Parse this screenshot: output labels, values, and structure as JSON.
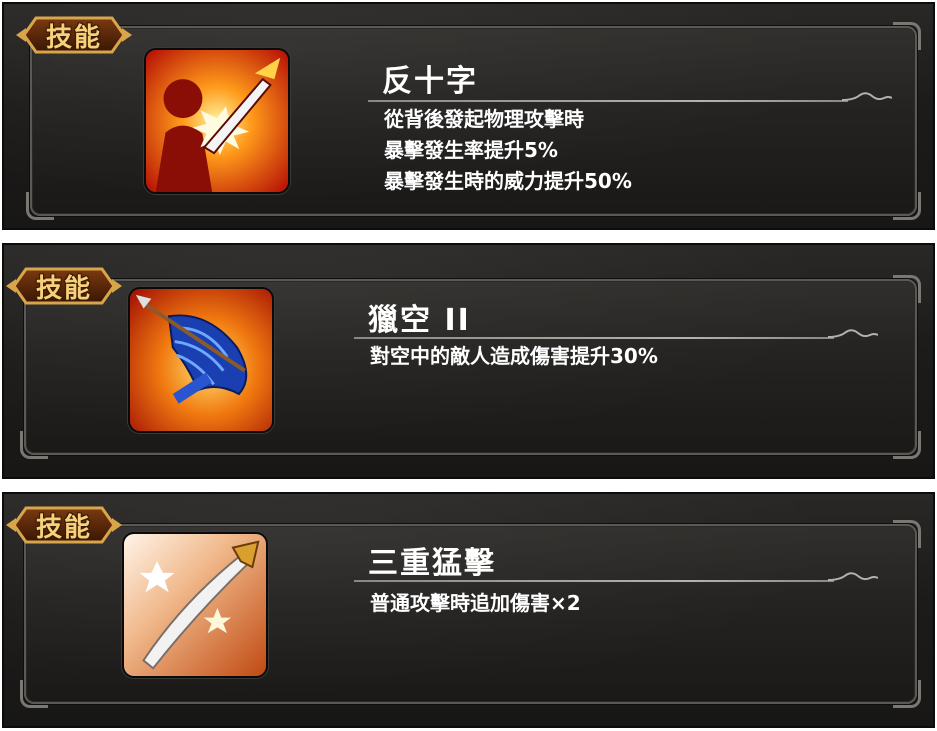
{
  "badge_label": "技能",
  "skills": [
    {
      "icon": "cross-strike-icon",
      "name": "反十字",
      "lines": [
        "從背後發起物理攻擊時",
        "暴擊發生率提升5%",
        "暴擊發生時的威力提升50%"
      ]
    },
    {
      "icon": "arrow-wing-icon",
      "name": "獵空 II",
      "lines": [
        "對空中的敵人造成傷害提升30%"
      ]
    },
    {
      "icon": "sword-slash-icon",
      "name": "三重猛擊",
      "lines": [
        "普通攻擊時追加傷害×2"
      ]
    }
  ],
  "colors": {
    "badge_gold": "#f6d07a",
    "panel": "#1c1b1a",
    "frame": "#5a5955"
  }
}
